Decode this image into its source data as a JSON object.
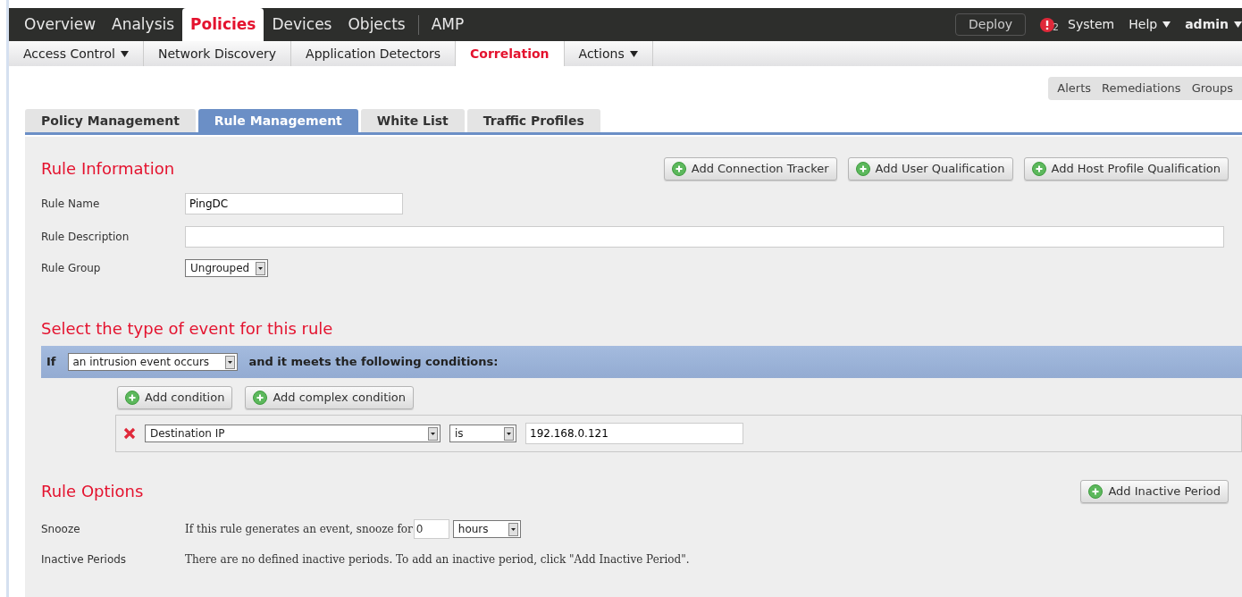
{
  "main_nav": {
    "items": [
      {
        "label": "Overview",
        "selected": false
      },
      {
        "label": "Analysis",
        "selected": false
      },
      {
        "label": "Policies",
        "selected": true
      },
      {
        "label": "Devices",
        "selected": false
      },
      {
        "label": "Objects",
        "selected": false
      },
      {
        "label": "AMP",
        "selected": false
      }
    ],
    "deploy": "Deploy",
    "alert_count": "2",
    "system": "System",
    "help": "Help",
    "user": "admin"
  },
  "sub_nav": [
    {
      "label": "Access Control",
      "selected": false,
      "dropdown": true
    },
    {
      "label": "Network Discovery",
      "selected": false,
      "dropdown": false
    },
    {
      "label": "Application Detectors",
      "selected": false,
      "dropdown": false
    },
    {
      "label": "Correlation",
      "selected": true,
      "dropdown": false
    },
    {
      "label": "Actions",
      "selected": false,
      "dropdown": true
    }
  ],
  "quick_links": [
    "Alerts",
    "Remediations",
    "Groups"
  ],
  "tabs": [
    {
      "label": "Policy Management",
      "selected": false
    },
    {
      "label": "Rule Management",
      "selected": true
    },
    {
      "label": "White List",
      "selected": false
    },
    {
      "label": "Traffic Profiles",
      "selected": false
    }
  ],
  "rule_information": {
    "title": "Rule Information",
    "buttons": [
      "Add Connection Tracker",
      "Add User Qualification",
      "Add Host Profile Qualification"
    ],
    "fields": [
      {
        "label": "Rule Name",
        "kind": "text",
        "value": "PingDC"
      },
      {
        "label": "Rule Description",
        "kind": "wide"
      },
      {
        "label": "Rule Group",
        "kind": "select",
        "value": "Ungrouped"
      }
    ]
  },
  "event": {
    "title": "Select the type of event for this rule",
    "if": "If",
    "event_type": "an intrusion event occurs",
    "suffix": "and it meets the following conditions:",
    "buttons": [
      "Add condition",
      "Add complex condition"
    ],
    "condition": {
      "field": "Destination IP",
      "operator": "is",
      "value": "192.168.0.121"
    }
  },
  "rule_options": {
    "title": "Rule Options",
    "button": "Add Inactive Period",
    "snooze": {
      "label": "Snooze",
      "text": "If this rule generates an event, snooze for",
      "value": "0",
      "unit": "hours"
    },
    "inactive": {
      "label": "Inactive Periods",
      "text": "There are no defined inactive periods. To add an inactive period, click \"Add Inactive Period\"."
    }
  }
}
